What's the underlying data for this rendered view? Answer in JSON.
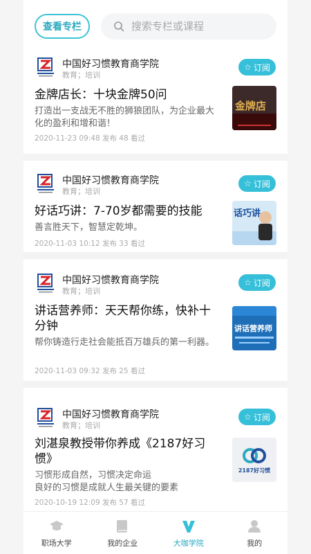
{
  "header": {
    "view_columns_label": "查看专栏",
    "search_placeholder": "搜索专栏或课程"
  },
  "cards": [
    {
      "org": "中国好习惯教育商学院",
      "tags": "教育；培训",
      "subscribe_label": "订阅",
      "title": "金牌店长：十块金牌50问",
      "desc": "打造出一支战无不胜的狮狼团队，为企业最大化的盈利和增和谐！",
      "meta": "2020-11-23 09:48 发布   48 看过",
      "thumb_text": "金牌店"
    },
    {
      "org": "中国好习惯教育商学院",
      "tags": "教育；培训",
      "subscribe_label": "订阅",
      "title": "好话巧讲：7-70岁都需要的技能",
      "desc": "善言胜天下，智慧定乾坤。",
      "meta": "2020-11-03 10:12 发布   33 看过",
      "thumb_text": "话巧讲"
    },
    {
      "org": "中国好习惯教育商学院",
      "tags": "教育；培训",
      "subscribe_label": "订阅",
      "title": "讲话营养师：天天帮你练，快补十分钟",
      "desc": "帮你铸造行走社会能抵百万雄兵的第一利器。",
      "meta": "2020-11-03 09:32 发布   25 看过",
      "thumb_text": "讲话营养师"
    },
    {
      "org": "中国好习惯教育商学院",
      "tags": "教育；培训",
      "subscribe_label": "订阅",
      "title": "刘湛泉教授带你养成《2187好习惯》",
      "desc": "习惯形成自然，习惯决定命运\n良好的习惯是成就人生最关键的要素",
      "meta": "2020-10-19 12:09 发布   57 看过",
      "thumb_text": "2187好习惯"
    }
  ],
  "tabbar": {
    "tabs": [
      "职场大学",
      "我的企业",
      "大咖学院",
      "我的"
    ],
    "active_index": 2
  },
  "colors": {
    "accent": "#36bfd8",
    "accent_text": "#2aa9c0"
  }
}
